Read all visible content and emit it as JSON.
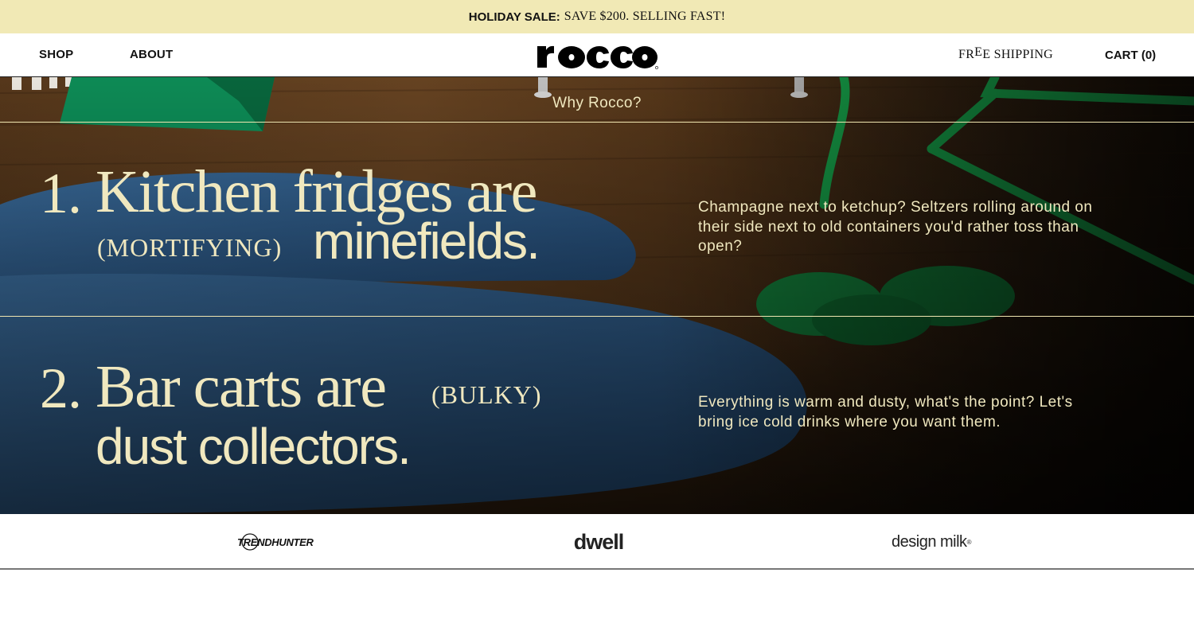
{
  "promo": {
    "bold": "HOLIDAY SALE:",
    "text": "SAVE $200. SELLING FAST!"
  },
  "header": {
    "nav": [
      {
        "label": "SHOP"
      },
      {
        "label": "ABOUT"
      }
    ],
    "logo": "rocco",
    "free_shipping": {
      "pre": "FR",
      "raised": "E",
      "post": "E SHIPPING"
    },
    "cart": "CART (0)"
  },
  "hero": {
    "eyebrow": "Why Rocco?",
    "items": [
      {
        "number": "1.",
        "serif_line": "Kitchen fridges are",
        "tag": "(MORTIFYING)",
        "sans_line": "minefields.",
        "description": "Champagne next to ketchup? Seltzers rolling around on their side next to old containers you'd rather toss than open?"
      },
      {
        "number": "2.",
        "serif_line": "Bar carts are",
        "tag": "(BULKY)",
        "sans_line": "dust collectors.",
        "description": "Everything is warm and dusty, what's the point? Let's bring ice cold drinks where you want them."
      }
    ],
    "colors": {
      "text": "#f0e8bf",
      "line": "#efe5b0"
    }
  },
  "press": {
    "items": [
      {
        "label": "TRENDHUNTER"
      },
      {
        "label": "dwell"
      },
      {
        "label": "design milk"
      }
    ],
    "design_milk_mark": "®"
  }
}
